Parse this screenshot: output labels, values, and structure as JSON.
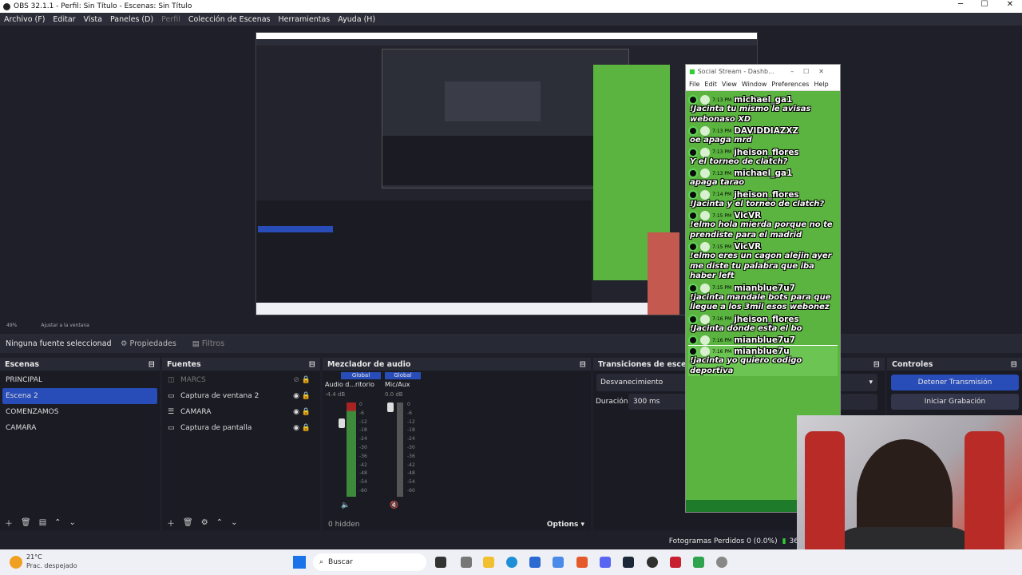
{
  "window": {
    "title": "OBS 32.1.1 - Perfil: Sin Título - Escenas: Sin Título"
  },
  "menu": {
    "items": [
      "Archivo (F)",
      "Editar",
      "Vista",
      "Paneles (D)",
      "Perfil",
      "Colección de Escenas",
      "Herramientas",
      "Ayuda (H)"
    ]
  },
  "zoom": {
    "level": "49%",
    "fit": "Ajustar a la ventana"
  },
  "context": {
    "no_source": "Ninguna fuente seleccionad",
    "properties": "Propiedades",
    "filters": "Filtros"
  },
  "scenes": {
    "title": "Escenas",
    "items": [
      "PRINCIPAL",
      "Escena 2",
      "COMENZAMOS",
      "CAMARA"
    ]
  },
  "sources": {
    "title": "Fuentes",
    "items": [
      "MARCS",
      "Captura de ventana 2",
      "CAMARA",
      "Captura de pantalla"
    ]
  },
  "mixer": {
    "title": "Mezclador de audio",
    "ch1_tag": "Global",
    "ch1_name": "Audio d...ritorio",
    "ch1_db": "-4.4 dB",
    "ch2_tag": "Global",
    "ch2_name": "Mic/Aux",
    "ch2_db": "0.0 dB",
    "ticks": [
      "0",
      "-6",
      "-12",
      "-18",
      "-24",
      "-30",
      "-36",
      "-42",
      "-48",
      "-54",
      "-60"
    ],
    "hidden": "0 hidden",
    "options": "Options"
  },
  "transitions": {
    "title": "Transiciones de escena",
    "type": "Desvanecimiento",
    "duration_label": "Duración",
    "duration_value": "300 ms"
  },
  "controls": {
    "title": "Controles",
    "stop_stream": "Detener Transmisión",
    "start_rec": "Iniciar Grabación"
  },
  "status": {
    "dropped": "Fotogramas Perdidos 0 (0.0%)",
    "bitrate": "36"
  },
  "chat": {
    "title": "Social Stream - Dashb...",
    "menu": [
      "File",
      "Edit",
      "View",
      "Window",
      "Preferences",
      "Help"
    ],
    "messages": [
      {
        "time": "7:13 PM",
        "user": "michael_ga1",
        "text": "!Jacinta tu mismo le avisas webonaso XD"
      },
      {
        "time": "7:13 PM",
        "user": "DAVIDDIAZXZ",
        "text": "oe apaga mrd"
      },
      {
        "time": "7:13 PM",
        "user": "jheison_flores",
        "text": "Y el torneo de clatch?"
      },
      {
        "time": "7:13 PM",
        "user": "michael_ga1",
        "text": "apaga tarao"
      },
      {
        "time": "7:14 PM",
        "user": "jheison_flores",
        "text": "!Jacinta y el torneo de clatch?"
      },
      {
        "time": "7:15 PM",
        "user": "VicVR",
        "text": "!elmo hola mierda porque no te prendiste para el madrid"
      },
      {
        "time": "7:15 PM",
        "user": "VicVR",
        "text": "!elmo eres un cagon alejin ayer me diste tu palabra que iba haber left"
      },
      {
        "time": "7:15 PM",
        "user": "mianblue7u7",
        "text": "!jacinta mandale bots para que llegue a los 3mil esos webonez"
      },
      {
        "time": "7:16 PM",
        "user": "jheison_flores",
        "text": "!Jacinta dónde esta el bo"
      },
      {
        "time": "7:16 PM",
        "user": "mianblue7u7",
        "text": ""
      },
      {
        "time": "7:16 PM",
        "user": "mianblue7u",
        "text": "!jacinta yo quiero codigo deportiva"
      }
    ]
  },
  "taskbar": {
    "weather_temp": "21°C",
    "weather_desc": "Prac. despejado",
    "search": "Buscar"
  }
}
